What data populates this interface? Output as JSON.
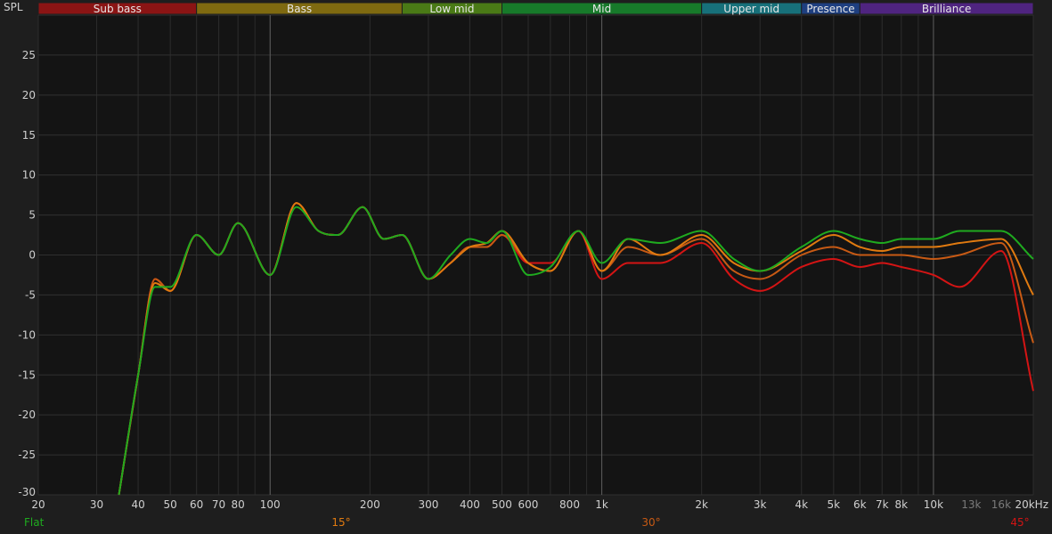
{
  "chart_data": {
    "type": "line",
    "ylabel": "SPL",
    "x_scale": "log",
    "xlim": [
      20,
      20000
    ],
    "ylim": [
      -30,
      30
    ],
    "grid": true,
    "y_ticks": [
      25,
      20,
      15,
      10,
      5,
      0,
      -5,
      -10,
      -15,
      -20,
      -25,
      -30
    ],
    "x_ticks": [
      {
        "value": 20,
        "label": "20",
        "dim": false
      },
      {
        "value": 30,
        "label": "30",
        "dim": false
      },
      {
        "value": 40,
        "label": "40",
        "dim": false
      },
      {
        "value": 50,
        "label": "50",
        "dim": false
      },
      {
        "value": 60,
        "label": "60",
        "dim": false
      },
      {
        "value": 70,
        "label": "70",
        "dim": false
      },
      {
        "value": 80,
        "label": "80",
        "dim": false
      },
      {
        "value": 100,
        "label": "100",
        "dim": false
      },
      {
        "value": 200,
        "label": "200",
        "dim": false
      },
      {
        "value": 300,
        "label": "300",
        "dim": false
      },
      {
        "value": 400,
        "label": "400",
        "dim": false
      },
      {
        "value": 500,
        "label": "500",
        "dim": false
      },
      {
        "value": 600,
        "label": "600",
        "dim": false
      },
      {
        "value": 800,
        "label": "800",
        "dim": false
      },
      {
        "value": 1000,
        "label": "1k",
        "dim": false
      },
      {
        "value": 2000,
        "label": "2k",
        "dim": false
      },
      {
        "value": 3000,
        "label": "3k",
        "dim": false
      },
      {
        "value": 4000,
        "label": "4k",
        "dim": false
      },
      {
        "value": 5000,
        "label": "5k",
        "dim": false
      },
      {
        "value": 6000,
        "label": "6k",
        "dim": false
      },
      {
        "value": 7000,
        "label": "7k",
        "dim": false
      },
      {
        "value": 8000,
        "label": "8k",
        "dim": false
      },
      {
        "value": 10000,
        "label": "10k",
        "dim": false
      },
      {
        "value": 13000,
        "label": "13k",
        "dim": true
      },
      {
        "value": 16000,
        "label": "16k",
        "dim": true
      },
      {
        "value": 20000,
        "label": "20kHz",
        "dim": false
      }
    ],
    "bands": [
      {
        "name": "Sub bass",
        "from": 20,
        "to": 60,
        "color": "#8b1414"
      },
      {
        "name": "Bass",
        "from": 60,
        "to": 250,
        "color": "#7f6a10"
      },
      {
        "name": "Low mid",
        "from": 250,
        "to": 500,
        "color": "#4a7a16"
      },
      {
        "name": "Mid",
        "from": 500,
        "to": 2000,
        "color": "#177a2a"
      },
      {
        "name": "Upper mid",
        "from": 2000,
        "to": 4000,
        "color": "#17707a"
      },
      {
        "name": "Presence",
        "from": 4000,
        "to": 6000,
        "color": "#1e3f80"
      },
      {
        "name": "Brilliance",
        "from": 6000,
        "to": 20000,
        "color": "#4f2480"
      }
    ],
    "series": [
      {
        "name": "Flat",
        "color": "#1faa1f",
        "x": [
          35,
          40,
          45,
          50,
          60,
          70,
          80,
          100,
          120,
          140,
          160,
          190,
          220,
          250,
          300,
          350,
          400,
          450,
          500,
          600,
          700,
          850,
          1000,
          1200,
          1500,
          2000,
          2500,
          3000,
          4000,
          5000,
          6000,
          7000,
          8000,
          10000,
          12000,
          16000,
          20000
        ],
        "y": [
          -30,
          -15,
          -4,
          -4,
          2.5,
          0,
          4,
          -2.5,
          6,
          3,
          2.5,
          6,
          2,
          2.5,
          -3,
          0,
          2,
          1.5,
          3,
          -2.5,
          -1.5,
          3,
          -1,
          2,
          1.5,
          3,
          -0.5,
          -2,
          1,
          3,
          2,
          1.5,
          2,
          2,
          3,
          3,
          -0.5
        ]
      },
      {
        "name": "15°",
        "color": "#e07a10",
        "x": [
          35,
          40,
          45,
          50,
          60,
          70,
          80,
          100,
          120,
          140,
          160,
          190,
          220,
          250,
          300,
          350,
          400,
          450,
          500,
          600,
          700,
          850,
          1000,
          1200,
          1500,
          2000,
          2500,
          3000,
          4000,
          5000,
          6000,
          7000,
          8000,
          10000,
          12000,
          16000,
          20000
        ],
        "y": [
          -30,
          -15,
          -3.5,
          -4.5,
          2.5,
          0,
          4,
          -2.5,
          6.5,
          3,
          2.5,
          6,
          2,
          2.5,
          -3,
          -1,
          1,
          1.5,
          3,
          -1,
          -2,
          3,
          -2,
          2,
          0,
          2.5,
          -1,
          -2,
          0.5,
          2.5,
          1,
          0.5,
          1,
          1,
          1.5,
          2,
          -5
        ]
      },
      {
        "name": "30°",
        "color": "#c85a14",
        "x": [
          35,
          40,
          45,
          50,
          60,
          70,
          80,
          100,
          120,
          140,
          160,
          190,
          220,
          250,
          300,
          350,
          400,
          450,
          500,
          600,
          700,
          850,
          1000,
          1200,
          1500,
          2000,
          2500,
          3000,
          4000,
          5000,
          6000,
          7000,
          8000,
          10000,
          12000,
          16000,
          20000
        ],
        "y": [
          -30,
          -15,
          -3,
          -4.5,
          2.5,
          0,
          4,
          -2.5,
          6.5,
          3,
          2.5,
          6,
          2,
          2.5,
          -3,
          -1,
          1,
          1,
          2.5,
          -1,
          -2,
          3,
          -2,
          1,
          0,
          2,
          -2,
          -3,
          0,
          1,
          0,
          0,
          0,
          -0.5,
          0,
          1.5,
          -11
        ]
      },
      {
        "name": "45°",
        "color": "#d41414",
        "x": [
          35,
          40,
          45,
          50,
          60,
          70,
          80,
          100,
          120,
          140,
          160,
          190,
          220,
          250,
          300,
          350,
          400,
          450,
          500,
          600,
          700,
          850,
          1000,
          1200,
          1500,
          2000,
          2500,
          3000,
          4000,
          5000,
          6000,
          7000,
          8000,
          10000,
          12000,
          16000,
          20000
        ],
        "y": [
          -30,
          -15,
          -3,
          -4.5,
          2.5,
          0,
          4,
          -2.5,
          6.5,
          3,
          2.5,
          6,
          2,
          2.5,
          -3,
          -1,
          1,
          1,
          2.5,
          -1,
          -1,
          3,
          -3,
          -1,
          -1,
          1.5,
          -3,
          -4.5,
          -1.5,
          -0.5,
          -1.5,
          -1,
          -1.5,
          -2.5,
          -4,
          0.5,
          -17
        ]
      }
    ]
  }
}
